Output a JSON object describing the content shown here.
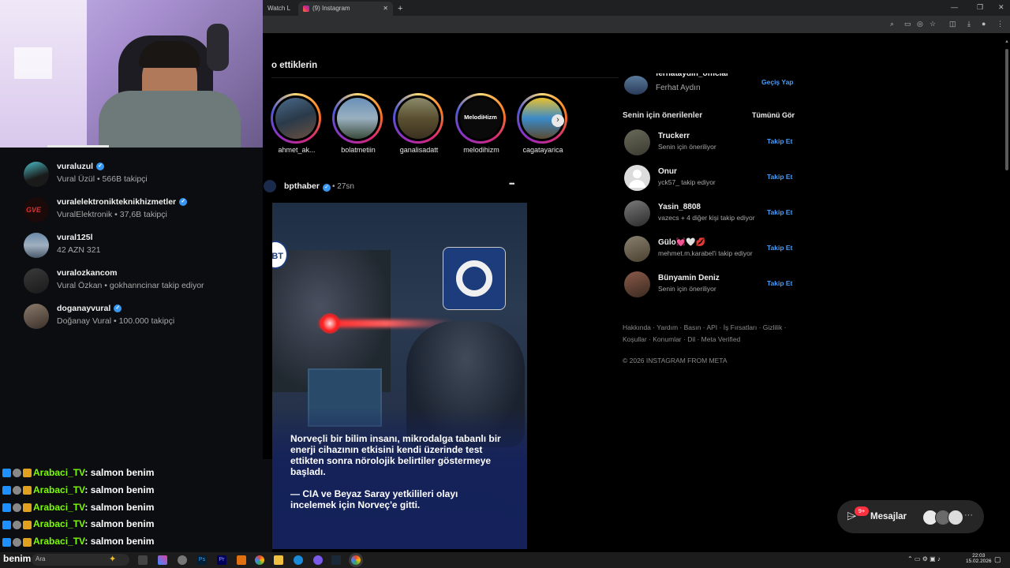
{
  "browser": {
    "tabs": [
      {
        "label": "Watch L"
      },
      {
        "label": "(9) Instagram"
      }
    ],
    "new_tab": "+",
    "win_min": "—",
    "win_max": "❐",
    "win_close": "✕"
  },
  "search_results": [
    {
      "username": "vuraluzul",
      "verified": true,
      "subtitle": "Vural Üzül • 566B takipçi"
    },
    {
      "username": "vuralelektronikteknikhizmetler",
      "verified": true,
      "subtitle": "VuralElektronik • 37,6B takipçi"
    },
    {
      "username": "vural125l",
      "verified": false,
      "subtitle": "42 AZN 321"
    },
    {
      "username": "vuralozkancom",
      "verified": false,
      "subtitle": "Vural Özkan • gokhanncinar takip ediyor"
    },
    {
      "username": "doganayvural",
      "verified": true,
      "subtitle": "Doğanay Vural • 100.000 takipçi"
    }
  ],
  "chat": {
    "user": "Arabaci_TV",
    "message": ": salmon benim",
    "lines": 5
  },
  "feed": {
    "section_heading": "o ettiklerin",
    "stories": [
      {
        "name": "ahmet_ak..."
      },
      {
        "name": "bolatmetiin"
      },
      {
        "name": "ganalisadatt"
      },
      {
        "name": "melodihizm",
        "logo_text": "MelodiHizm"
      },
      {
        "name": "cagatayarica"
      }
    ],
    "post": {
      "author": "bpthaber",
      "time": "27sn",
      "more": "•••",
      "headline": "Norveçli bir bilim insanı, mikrodalga tabanlı bir enerji cihazının etkisini kendi üzerinde test ettikten sonra nörolojik belirtiler göstermeye başladı.",
      "subline": "— CIA ve Beyaz Saray yetkilileri olayı incelemek için Norveç'e gitti.",
      "badge": "BT"
    }
  },
  "sidebar": {
    "account": {
      "username": "ferhataydin_official",
      "name": "Ferhat Aydın",
      "switch": "Geçiş Yap"
    },
    "suggestions_title": "Senin için önerilenler",
    "see_all": "Tümünü Gör",
    "follow_label": "Takip Et",
    "suggestions": [
      {
        "name": "Truckerr",
        "sub": "Senin için öneriliyor"
      },
      {
        "name": "Onur",
        "sub": "yck57_ takip ediyor"
      },
      {
        "name": "Yasin_8808",
        "sub": "vazecs + 4 diğer kişi takip ediyor"
      },
      {
        "name": "Gülo💓🤍💋",
        "sub": "mehmet.m.karabel'i takip ediyor"
      },
      {
        "name": "Bünyamin Deniz",
        "sub": "Senin için öneriliyor"
      }
    ],
    "footer_line1": "Hakkında · Yardım · Basın · API · İş Fırsatları · Gizlilik ·",
    "footer_line2": "Koşullar · Konumlar · Dil · Meta Verified",
    "copyright": "© 2026 INSTAGRAM FROM META"
  },
  "messages": {
    "label": "Mesajlar",
    "badge": "9+"
  },
  "taskbar": {
    "search_placeholder": "Ara",
    "overlay_text": "benim",
    "time": "22:03",
    "date": "15.02.2026"
  }
}
